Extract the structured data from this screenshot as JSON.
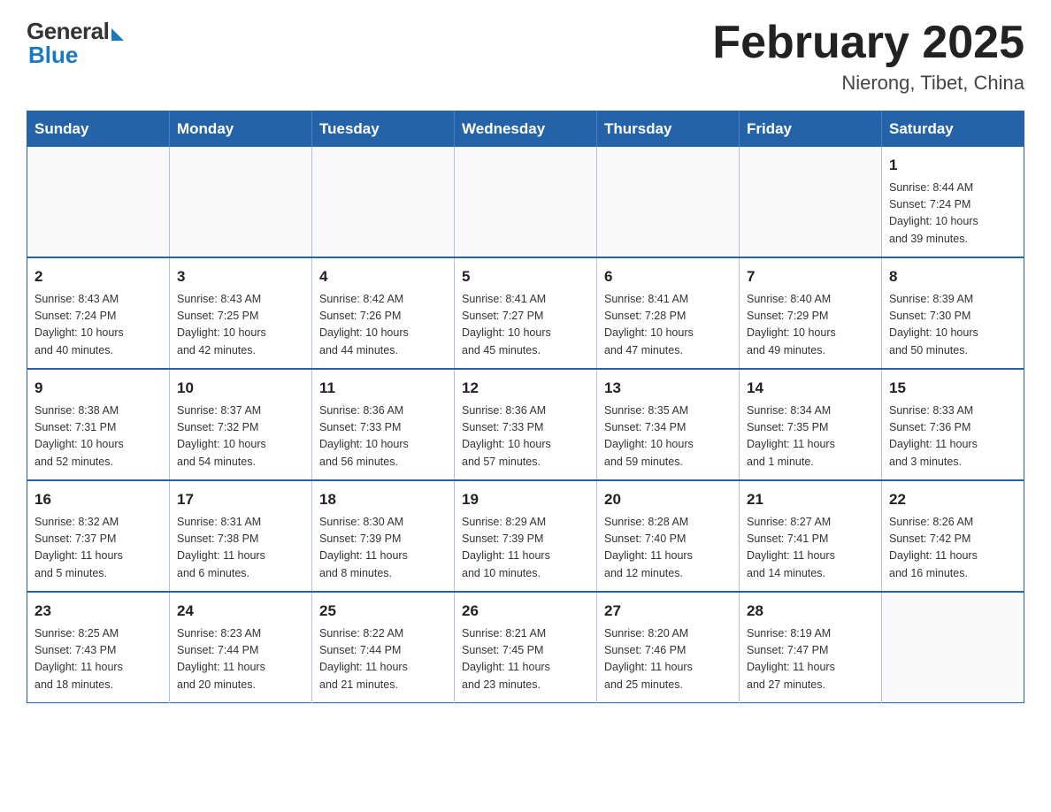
{
  "header": {
    "logo_general": "General",
    "logo_blue": "Blue",
    "month_title": "February 2025",
    "location": "Nierong, Tibet, China"
  },
  "weekdays": [
    "Sunday",
    "Monday",
    "Tuesday",
    "Wednesday",
    "Thursday",
    "Friday",
    "Saturday"
  ],
  "weeks": [
    [
      {
        "day": "",
        "info": ""
      },
      {
        "day": "",
        "info": ""
      },
      {
        "day": "",
        "info": ""
      },
      {
        "day": "",
        "info": ""
      },
      {
        "day": "",
        "info": ""
      },
      {
        "day": "",
        "info": ""
      },
      {
        "day": "1",
        "info": "Sunrise: 8:44 AM\nSunset: 7:24 PM\nDaylight: 10 hours\nand 39 minutes."
      }
    ],
    [
      {
        "day": "2",
        "info": "Sunrise: 8:43 AM\nSunset: 7:24 PM\nDaylight: 10 hours\nand 40 minutes."
      },
      {
        "day": "3",
        "info": "Sunrise: 8:43 AM\nSunset: 7:25 PM\nDaylight: 10 hours\nand 42 minutes."
      },
      {
        "day": "4",
        "info": "Sunrise: 8:42 AM\nSunset: 7:26 PM\nDaylight: 10 hours\nand 44 minutes."
      },
      {
        "day": "5",
        "info": "Sunrise: 8:41 AM\nSunset: 7:27 PM\nDaylight: 10 hours\nand 45 minutes."
      },
      {
        "day": "6",
        "info": "Sunrise: 8:41 AM\nSunset: 7:28 PM\nDaylight: 10 hours\nand 47 minutes."
      },
      {
        "day": "7",
        "info": "Sunrise: 8:40 AM\nSunset: 7:29 PM\nDaylight: 10 hours\nand 49 minutes."
      },
      {
        "day": "8",
        "info": "Sunrise: 8:39 AM\nSunset: 7:30 PM\nDaylight: 10 hours\nand 50 minutes."
      }
    ],
    [
      {
        "day": "9",
        "info": "Sunrise: 8:38 AM\nSunset: 7:31 PM\nDaylight: 10 hours\nand 52 minutes."
      },
      {
        "day": "10",
        "info": "Sunrise: 8:37 AM\nSunset: 7:32 PM\nDaylight: 10 hours\nand 54 minutes."
      },
      {
        "day": "11",
        "info": "Sunrise: 8:36 AM\nSunset: 7:33 PM\nDaylight: 10 hours\nand 56 minutes."
      },
      {
        "day": "12",
        "info": "Sunrise: 8:36 AM\nSunset: 7:33 PM\nDaylight: 10 hours\nand 57 minutes."
      },
      {
        "day": "13",
        "info": "Sunrise: 8:35 AM\nSunset: 7:34 PM\nDaylight: 10 hours\nand 59 minutes."
      },
      {
        "day": "14",
        "info": "Sunrise: 8:34 AM\nSunset: 7:35 PM\nDaylight: 11 hours\nand 1 minute."
      },
      {
        "day": "15",
        "info": "Sunrise: 8:33 AM\nSunset: 7:36 PM\nDaylight: 11 hours\nand 3 minutes."
      }
    ],
    [
      {
        "day": "16",
        "info": "Sunrise: 8:32 AM\nSunset: 7:37 PM\nDaylight: 11 hours\nand 5 minutes."
      },
      {
        "day": "17",
        "info": "Sunrise: 8:31 AM\nSunset: 7:38 PM\nDaylight: 11 hours\nand 6 minutes."
      },
      {
        "day": "18",
        "info": "Sunrise: 8:30 AM\nSunset: 7:39 PM\nDaylight: 11 hours\nand 8 minutes."
      },
      {
        "day": "19",
        "info": "Sunrise: 8:29 AM\nSunset: 7:39 PM\nDaylight: 11 hours\nand 10 minutes."
      },
      {
        "day": "20",
        "info": "Sunrise: 8:28 AM\nSunset: 7:40 PM\nDaylight: 11 hours\nand 12 minutes."
      },
      {
        "day": "21",
        "info": "Sunrise: 8:27 AM\nSunset: 7:41 PM\nDaylight: 11 hours\nand 14 minutes."
      },
      {
        "day": "22",
        "info": "Sunrise: 8:26 AM\nSunset: 7:42 PM\nDaylight: 11 hours\nand 16 minutes."
      }
    ],
    [
      {
        "day": "23",
        "info": "Sunrise: 8:25 AM\nSunset: 7:43 PM\nDaylight: 11 hours\nand 18 minutes."
      },
      {
        "day": "24",
        "info": "Sunrise: 8:23 AM\nSunset: 7:44 PM\nDaylight: 11 hours\nand 20 minutes."
      },
      {
        "day": "25",
        "info": "Sunrise: 8:22 AM\nSunset: 7:44 PM\nDaylight: 11 hours\nand 21 minutes."
      },
      {
        "day": "26",
        "info": "Sunrise: 8:21 AM\nSunset: 7:45 PM\nDaylight: 11 hours\nand 23 minutes."
      },
      {
        "day": "27",
        "info": "Sunrise: 8:20 AM\nSunset: 7:46 PM\nDaylight: 11 hours\nand 25 minutes."
      },
      {
        "day": "28",
        "info": "Sunrise: 8:19 AM\nSunset: 7:47 PM\nDaylight: 11 hours\nand 27 minutes."
      },
      {
        "day": "",
        "info": ""
      }
    ]
  ]
}
